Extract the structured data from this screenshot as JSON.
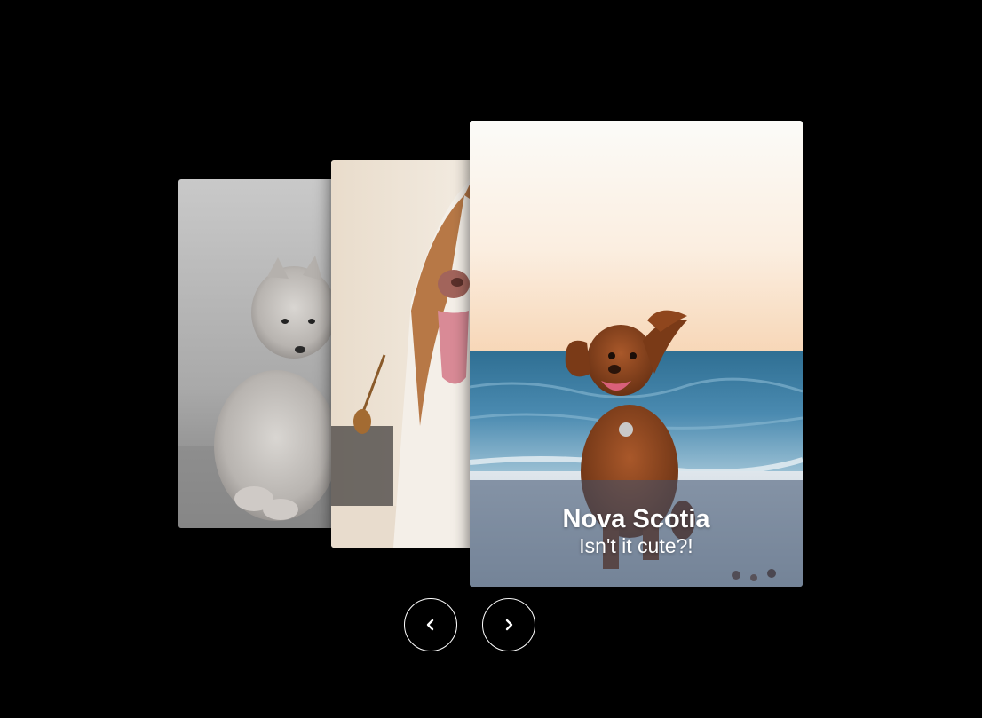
{
  "carousel": {
    "slides": [
      {
        "image": "grey-pomeranian-puppy-photo"
      },
      {
        "image": "husky-tongue-out-photo"
      },
      {
        "image": "brown-dog-running-on-beach-photo",
        "title": "Nova Scotia",
        "subtitle": "Isn't it cute?!"
      }
    ],
    "controls": {
      "prev_icon": "chevron-left-icon",
      "next_icon": "chevron-right-icon"
    }
  },
  "colors": {
    "background": "#000000",
    "caption_overlay": "rgba(60,80,110,0.55)",
    "button_border": "#ffffff"
  }
}
